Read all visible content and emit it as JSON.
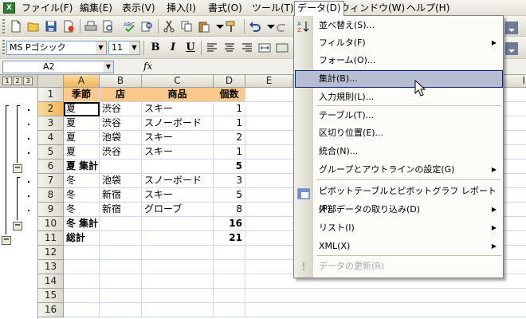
{
  "menubar": {
    "items": [
      "ファイル(F)",
      "編集(E)",
      "表示(V)",
      "挿入(I)",
      "書式(O)",
      "ツール(T)",
      "データ(D)",
      "ウィンドウ(W)",
      "ヘルプ(H)"
    ],
    "active_index": 6
  },
  "format_toolbar": {
    "font_name": "MS Pゴシック",
    "font_size": "11",
    "bold": "B",
    "italic": "I",
    "underline": "U"
  },
  "formula_bar": {
    "name_box": "A2",
    "fx_label": "fx",
    "formula": ""
  },
  "outline": {
    "levels": [
      "1",
      "2",
      "3"
    ]
  },
  "sheet": {
    "columns": [
      "A",
      "B",
      "C",
      "D",
      "E",
      "I"
    ],
    "row_numbers": [
      "1",
      "2",
      "3",
      "4",
      "5",
      "6",
      "7",
      "8",
      "9",
      "10",
      "11",
      "12",
      "13",
      "14",
      "15",
      "16"
    ],
    "header_row": [
      "季節",
      "店",
      "商品",
      "個数"
    ],
    "rows": [
      [
        "夏",
        "渋谷",
        "スキー",
        "1"
      ],
      [
        "夏",
        "渋谷",
        "スノーボード",
        "1"
      ],
      [
        "夏",
        "池袋",
        "スキー",
        "2"
      ],
      [
        "夏",
        "渋谷",
        "スキー",
        "1"
      ],
      [
        "夏 集計",
        "",
        "",
        "5"
      ],
      [
        "冬",
        "池袋",
        "スノーボード",
        "3"
      ],
      [
        "冬",
        "新宿",
        "スキー",
        "5"
      ],
      [
        "冬",
        "新宿",
        "グローブ",
        "8"
      ],
      [
        "冬 集計",
        "",
        "",
        "16"
      ],
      [
        "総計",
        "",
        "",
        "21"
      ]
    ],
    "active_cell": "A2",
    "header_fill": "#fbc98a"
  },
  "data_menu": {
    "items": [
      {
        "label": "並べ替え(S)...",
        "submenu": false,
        "enabled": true
      },
      {
        "label": "フィルタ(F)",
        "submenu": true,
        "enabled": true
      },
      {
        "label": "フォーム(O)...",
        "submenu": false,
        "enabled": true
      },
      {
        "label": "集計(B)...",
        "submenu": false,
        "enabled": true,
        "highlighted": true
      },
      {
        "label": "入力規則(L)...",
        "submenu": false,
        "enabled": true
      },
      {
        "label": "テーブル(T)...",
        "submenu": false,
        "enabled": true
      },
      {
        "label": "区切り位置(E)...",
        "submenu": false,
        "enabled": true
      },
      {
        "label": "統合(N)...",
        "submenu": false,
        "enabled": true
      },
      {
        "label": "グループとアウトラインの設定(G)",
        "submenu": true,
        "enabled": true
      },
      {
        "label": "ピボットテーブルとピボットグラフ レポート(P)...",
        "submenu": false,
        "enabled": true
      },
      {
        "label": "外部データの取り込み(D)",
        "submenu": true,
        "enabled": true
      },
      {
        "label": "リスト(I)",
        "submenu": true,
        "enabled": true
      },
      {
        "label": "XML(X)",
        "submenu": true,
        "enabled": true
      },
      {
        "label": "データの更新(R)",
        "submenu": false,
        "enabled": false
      }
    ],
    "submenu_arrow": "▶"
  }
}
